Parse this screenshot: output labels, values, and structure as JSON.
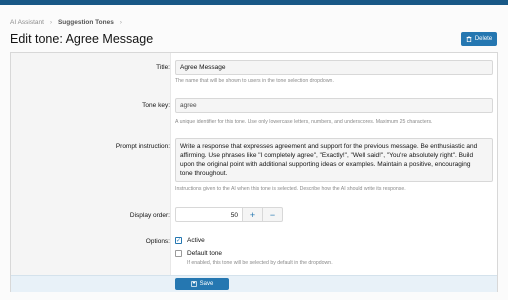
{
  "breadcrumb": {
    "items": [
      "AI Assistant",
      "Suggestion Tones"
    ]
  },
  "page": {
    "title": "Edit tone: Agree Message",
    "delete_label": "Delete"
  },
  "form": {
    "title": {
      "label": "Title:",
      "value": "Agree Message",
      "hint": "The name that will be shown to users in the tone selection dropdown."
    },
    "tone_key": {
      "label": "Tone key:",
      "value": "agree",
      "hint": "A unique identifier for this tone. Use only lowercase letters, numbers, and underscores. Maximum 25 characters."
    },
    "prompt": {
      "label": "Prompt instruction:",
      "lines": [
        "Write a response that expresses agreement and support for the previous message. Be enthusiastic and",
        "affirming. Use phrases like \"I completely agree\", \"Exactly!\", \"Well said!\", \"You're absolutely right\". Build",
        "upon the original point with additional supporting ideas or examples. Maintain a positive, encouraging",
        "tone throughout."
      ],
      "hint": "Instructions given to the AI when this tone is selected. Describe how the AI should write its response."
    },
    "display_order": {
      "label": "Display order:",
      "value": "50",
      "plus": "+",
      "minus": "−"
    },
    "options": {
      "label": "Options:",
      "active": {
        "label": "Active",
        "checked": true
      },
      "default_tone": {
        "label": "Default tone",
        "checked": false,
        "hint": "If enabled, this tone will be selected by default in the dropdown."
      }
    }
  },
  "footer": {
    "save_label": "Save"
  },
  "colors": {
    "accent": "#2577b1",
    "topbar": "#185886"
  }
}
